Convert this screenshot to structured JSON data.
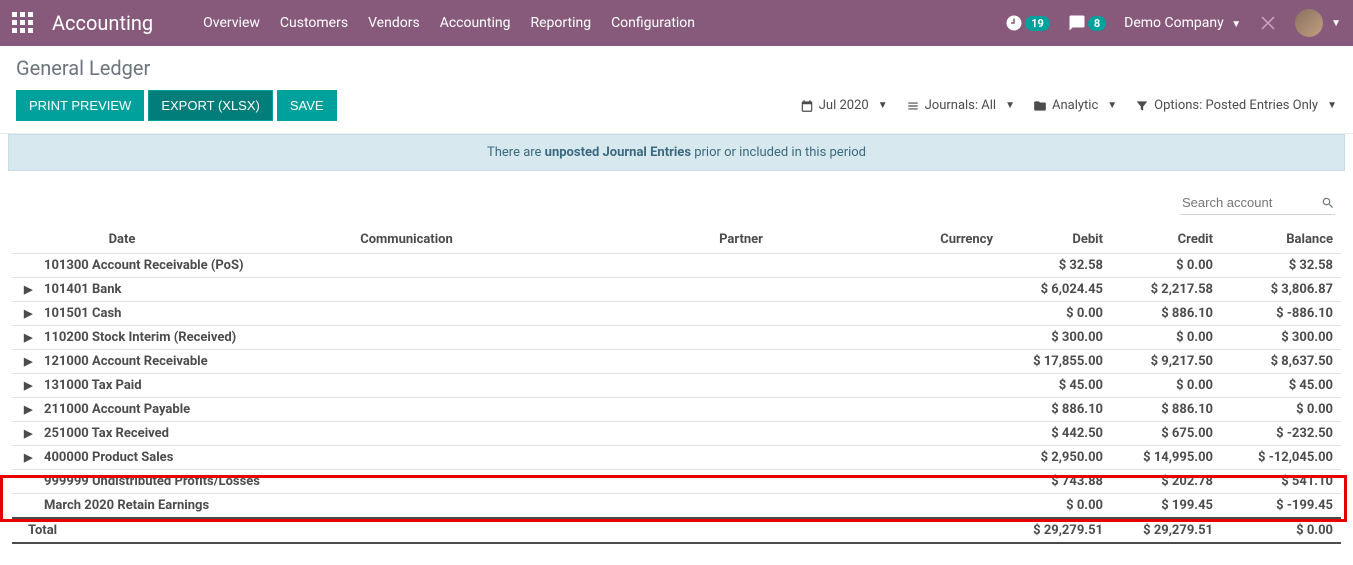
{
  "navbar": {
    "brand": "Accounting",
    "links": [
      "Overview",
      "Customers",
      "Vendors",
      "Accounting",
      "Reporting",
      "Configuration"
    ],
    "timer_badge": "19",
    "msg_badge": "8",
    "company": "Demo Company"
  },
  "breadcrumb": "General Ledger",
  "buttons": {
    "print": "PRINT PREVIEW",
    "export": "EXPORT (XLSX)",
    "save": "SAVE"
  },
  "filters": {
    "date": "Jul 2020",
    "journals": "Journals: All",
    "analytic": "Analytic",
    "options": "Options: Posted Entries Only"
  },
  "alert": {
    "pre": "There are ",
    "bold": "unposted Journal Entries",
    "post": " prior or included in this period"
  },
  "search_placeholder": "Search account",
  "headers": {
    "date": "Date",
    "communication": "Communication",
    "partner": "Partner",
    "currency": "Currency",
    "debit": "Debit",
    "credit": "Credit",
    "balance": "Balance"
  },
  "rows": [
    {
      "has_caret": false,
      "name": "101300 Account Receivable (PoS)",
      "debit": "$ 32.58",
      "credit": "$ 0.00",
      "balance": "$ 32.58"
    },
    {
      "has_caret": true,
      "name": "101401 Bank",
      "debit": "$ 6,024.45",
      "credit": "$ 2,217.58",
      "balance": "$ 3,806.87"
    },
    {
      "has_caret": true,
      "name": "101501 Cash",
      "debit": "$ 0.00",
      "credit": "$ 886.10",
      "balance": "$ -886.10"
    },
    {
      "has_caret": true,
      "name": "110200 Stock Interim (Received)",
      "debit": "$ 300.00",
      "credit": "$ 0.00",
      "balance": "$ 300.00"
    },
    {
      "has_caret": true,
      "name": "121000 Account Receivable",
      "debit": "$ 17,855.00",
      "credit": "$ 9,217.50",
      "balance": "$ 8,637.50"
    },
    {
      "has_caret": true,
      "name": "131000 Tax Paid",
      "debit": "$ 45.00",
      "credit": "$ 0.00",
      "balance": "$ 45.00"
    },
    {
      "has_caret": true,
      "name": "211000 Account Payable",
      "debit": "$ 886.10",
      "credit": "$ 886.10",
      "balance": "$ 0.00"
    },
    {
      "has_caret": true,
      "name": "251000 Tax Received",
      "debit": "$ 442.50",
      "credit": "$ 675.00",
      "balance": "$ -232.50"
    },
    {
      "has_caret": true,
      "name": "400000 Product Sales",
      "debit": "$ 2,950.00",
      "credit": "$ 14,995.00",
      "balance": "$ -12,045.00"
    },
    {
      "has_caret": false,
      "name": "999999 Undistributed Profits/Losses",
      "debit": "$ 743.88",
      "credit": "$ 202.78",
      "balance": "$ 541.10"
    },
    {
      "has_caret": false,
      "name": "March 2020 Retain Earnings",
      "debit": "$ 0.00",
      "credit": "$ 199.45",
      "balance": "$ -199.45"
    }
  ],
  "total": {
    "label": "Total",
    "debit": "$ 29,279.51",
    "credit": "$ 29,279.51",
    "balance": "$ 0.00"
  }
}
